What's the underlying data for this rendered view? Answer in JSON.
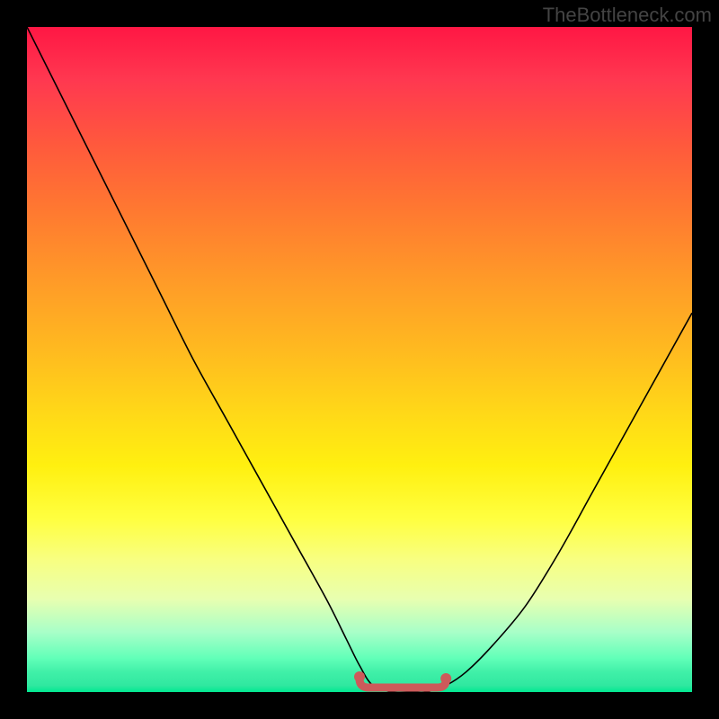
{
  "watermark": "TheBottleneck.com",
  "chart_data": {
    "type": "line",
    "title": "",
    "xlabel": "",
    "ylabel": "",
    "xlim": [
      0,
      100
    ],
    "ylim": [
      0,
      100
    ],
    "x": [
      0,
      5,
      10,
      15,
      20,
      25,
      30,
      35,
      40,
      45,
      48,
      50,
      52,
      55,
      58,
      60,
      63,
      66,
      70,
      75,
      80,
      85,
      90,
      95,
      100
    ],
    "values": [
      100,
      90,
      80,
      70,
      60,
      50,
      41,
      32,
      23,
      14,
      8,
      4,
      1,
      0,
      0,
      0,
      1,
      3,
      7,
      13,
      21,
      30,
      39,
      48,
      57
    ],
    "trough_marker": {
      "x_start": 50,
      "x_end": 63,
      "y": 0,
      "color": "#d06060"
    },
    "background": {
      "type": "vertical-gradient",
      "stops": [
        {
          "pos": 0,
          "color": "#ff1744"
        },
        {
          "pos": 50,
          "color": "#ffd818"
        },
        {
          "pos": 80,
          "color": "#ffff60"
        },
        {
          "pos": 100,
          "color": "#00e890"
        }
      ]
    }
  }
}
